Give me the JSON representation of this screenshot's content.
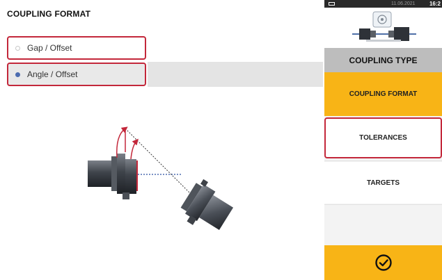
{
  "coupling_format": {
    "title": "COUPLING FORMAT",
    "options": [
      {
        "label": "Gap / Offset",
        "selected": false
      },
      {
        "label": "Angle / Offset",
        "selected": true
      }
    ]
  },
  "status_bar": {
    "date": "11.06.2021",
    "time": "16:2"
  },
  "menu": {
    "coupling_type": "COUPLING TYPE",
    "coupling_format": "COUPLING FORMAT",
    "tolerances": "TOLERANCES",
    "targets": "TARGETS",
    "confirm_icon": "check-circle-icon"
  },
  "colors": {
    "accent_yellow": "#f8b416",
    "highlight_red": "#c3273a",
    "selected_radio": "#4d6cb0",
    "header_gray": "#bdbdbd"
  }
}
